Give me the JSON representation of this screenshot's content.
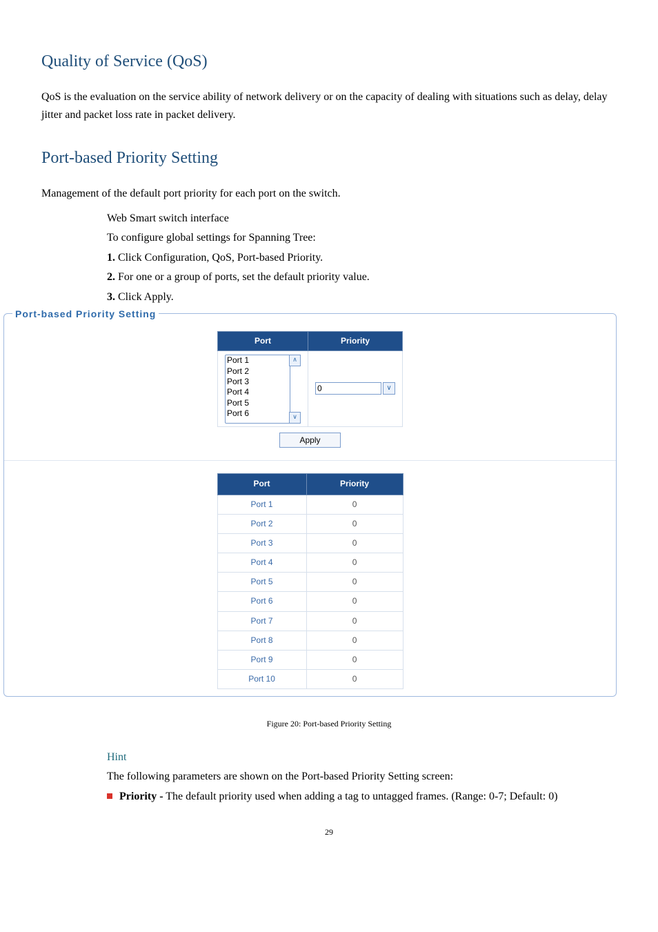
{
  "sections": {
    "qos_title": "Quality of Service (QoS)",
    "qos_text": "QoS is the evaluation on the service ability of network delivery or on the capacity of dealing with situations such as delay, delay jitter and packet loss rate in packet delivery.",
    "port_title": "Port-based Priority Setting",
    "port_text": "Management of the default port priority for each port on the switch.",
    "iface_label": "Web Smart switch interface",
    "conf_label": "To configure global settings for Spanning Tree:",
    "steps": {
      "s1_num": "1.",
      "s1_text": " Click Configuration, QoS, Port-based Priority.",
      "s2_num": "2.",
      "s2_text": " For one or a group of ports, set the default priority value.",
      "s3_num": "3.",
      "s3_text": " Click Apply."
    }
  },
  "ui": {
    "group_title": "Port-based Priority  Setting",
    "th_port": "Port",
    "th_priority": "Priority",
    "port_options": [
      "Port 1",
      "Port 2",
      "Port 3",
      "Port 4",
      "Port 5",
      "Port 6"
    ],
    "priority_value": "0",
    "apply_label": "Apply",
    "status_rows": [
      {
        "port": "Port 1",
        "prio": "0"
      },
      {
        "port": "Port 2",
        "prio": "0"
      },
      {
        "port": "Port 3",
        "prio": "0"
      },
      {
        "port": "Port 4",
        "prio": "0"
      },
      {
        "port": "Port 5",
        "prio": "0"
      },
      {
        "port": "Port 6",
        "prio": "0"
      },
      {
        "port": "Port 7",
        "prio": "0"
      },
      {
        "port": "Port 8",
        "prio": "0"
      },
      {
        "port": "Port 9",
        "prio": "0"
      },
      {
        "port": "Port 10",
        "prio": "0"
      }
    ]
  },
  "figure_caption": "Figure 20: Port-based Priority Setting",
  "hint": {
    "title": "Hint",
    "line": "The following parameters are shown on the Port-based Priority Setting screen:",
    "priority_label": "Priority -",
    "priority_desc": " The default priority used when adding a tag to untagged frames. (Range: 0-7; Default: 0)"
  },
  "page_number": "29",
  "icons": {
    "up": "∧",
    "down": "∨",
    "dropdown": "∨"
  }
}
